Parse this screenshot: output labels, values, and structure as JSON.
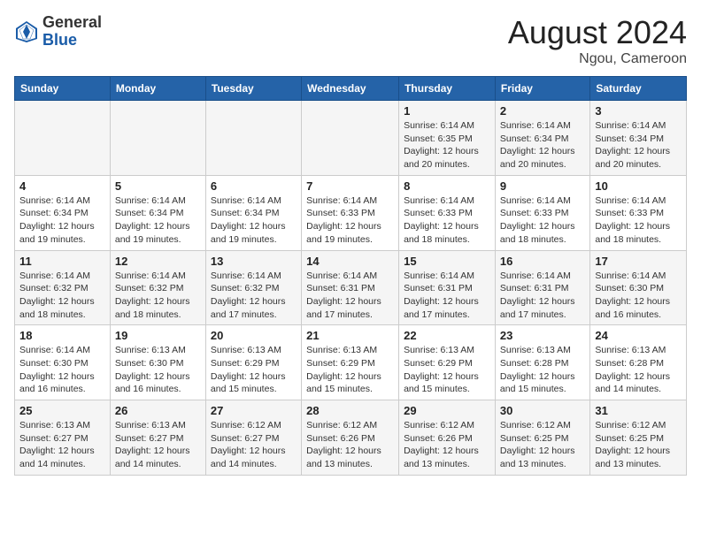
{
  "header": {
    "logo_general": "General",
    "logo_blue": "Blue",
    "month_year": "August 2024",
    "location": "Ngou, Cameroon"
  },
  "days_of_week": [
    "Sunday",
    "Monday",
    "Tuesday",
    "Wednesday",
    "Thursday",
    "Friday",
    "Saturday"
  ],
  "weeks": [
    [
      {
        "day": "",
        "info": ""
      },
      {
        "day": "",
        "info": ""
      },
      {
        "day": "",
        "info": ""
      },
      {
        "day": "",
        "info": ""
      },
      {
        "day": "1",
        "info": "Sunrise: 6:14 AM\nSunset: 6:35 PM\nDaylight: 12 hours\nand 20 minutes."
      },
      {
        "day": "2",
        "info": "Sunrise: 6:14 AM\nSunset: 6:34 PM\nDaylight: 12 hours\nand 20 minutes."
      },
      {
        "day": "3",
        "info": "Sunrise: 6:14 AM\nSunset: 6:34 PM\nDaylight: 12 hours\nand 20 minutes."
      }
    ],
    [
      {
        "day": "4",
        "info": "Sunrise: 6:14 AM\nSunset: 6:34 PM\nDaylight: 12 hours\nand 19 minutes."
      },
      {
        "day": "5",
        "info": "Sunrise: 6:14 AM\nSunset: 6:34 PM\nDaylight: 12 hours\nand 19 minutes."
      },
      {
        "day": "6",
        "info": "Sunrise: 6:14 AM\nSunset: 6:34 PM\nDaylight: 12 hours\nand 19 minutes."
      },
      {
        "day": "7",
        "info": "Sunrise: 6:14 AM\nSunset: 6:33 PM\nDaylight: 12 hours\nand 19 minutes."
      },
      {
        "day": "8",
        "info": "Sunrise: 6:14 AM\nSunset: 6:33 PM\nDaylight: 12 hours\nand 18 minutes."
      },
      {
        "day": "9",
        "info": "Sunrise: 6:14 AM\nSunset: 6:33 PM\nDaylight: 12 hours\nand 18 minutes."
      },
      {
        "day": "10",
        "info": "Sunrise: 6:14 AM\nSunset: 6:33 PM\nDaylight: 12 hours\nand 18 minutes."
      }
    ],
    [
      {
        "day": "11",
        "info": "Sunrise: 6:14 AM\nSunset: 6:32 PM\nDaylight: 12 hours\nand 18 minutes."
      },
      {
        "day": "12",
        "info": "Sunrise: 6:14 AM\nSunset: 6:32 PM\nDaylight: 12 hours\nand 18 minutes."
      },
      {
        "day": "13",
        "info": "Sunrise: 6:14 AM\nSunset: 6:32 PM\nDaylight: 12 hours\nand 17 minutes."
      },
      {
        "day": "14",
        "info": "Sunrise: 6:14 AM\nSunset: 6:31 PM\nDaylight: 12 hours\nand 17 minutes."
      },
      {
        "day": "15",
        "info": "Sunrise: 6:14 AM\nSunset: 6:31 PM\nDaylight: 12 hours\nand 17 minutes."
      },
      {
        "day": "16",
        "info": "Sunrise: 6:14 AM\nSunset: 6:31 PM\nDaylight: 12 hours\nand 17 minutes."
      },
      {
        "day": "17",
        "info": "Sunrise: 6:14 AM\nSunset: 6:30 PM\nDaylight: 12 hours\nand 16 minutes."
      }
    ],
    [
      {
        "day": "18",
        "info": "Sunrise: 6:14 AM\nSunset: 6:30 PM\nDaylight: 12 hours\nand 16 minutes."
      },
      {
        "day": "19",
        "info": "Sunrise: 6:13 AM\nSunset: 6:30 PM\nDaylight: 12 hours\nand 16 minutes."
      },
      {
        "day": "20",
        "info": "Sunrise: 6:13 AM\nSunset: 6:29 PM\nDaylight: 12 hours\nand 15 minutes."
      },
      {
        "day": "21",
        "info": "Sunrise: 6:13 AM\nSunset: 6:29 PM\nDaylight: 12 hours\nand 15 minutes."
      },
      {
        "day": "22",
        "info": "Sunrise: 6:13 AM\nSunset: 6:29 PM\nDaylight: 12 hours\nand 15 minutes."
      },
      {
        "day": "23",
        "info": "Sunrise: 6:13 AM\nSunset: 6:28 PM\nDaylight: 12 hours\nand 15 minutes."
      },
      {
        "day": "24",
        "info": "Sunrise: 6:13 AM\nSunset: 6:28 PM\nDaylight: 12 hours\nand 14 minutes."
      }
    ],
    [
      {
        "day": "25",
        "info": "Sunrise: 6:13 AM\nSunset: 6:27 PM\nDaylight: 12 hours\nand 14 minutes."
      },
      {
        "day": "26",
        "info": "Sunrise: 6:13 AM\nSunset: 6:27 PM\nDaylight: 12 hours\nand 14 minutes."
      },
      {
        "day": "27",
        "info": "Sunrise: 6:12 AM\nSunset: 6:27 PM\nDaylight: 12 hours\nand 14 minutes."
      },
      {
        "day": "28",
        "info": "Sunrise: 6:12 AM\nSunset: 6:26 PM\nDaylight: 12 hours\nand 13 minutes."
      },
      {
        "day": "29",
        "info": "Sunrise: 6:12 AM\nSunset: 6:26 PM\nDaylight: 12 hours\nand 13 minutes."
      },
      {
        "day": "30",
        "info": "Sunrise: 6:12 AM\nSunset: 6:25 PM\nDaylight: 12 hours\nand 13 minutes."
      },
      {
        "day": "31",
        "info": "Sunrise: 6:12 AM\nSunset: 6:25 PM\nDaylight: 12 hours\nand 13 minutes."
      }
    ]
  ]
}
